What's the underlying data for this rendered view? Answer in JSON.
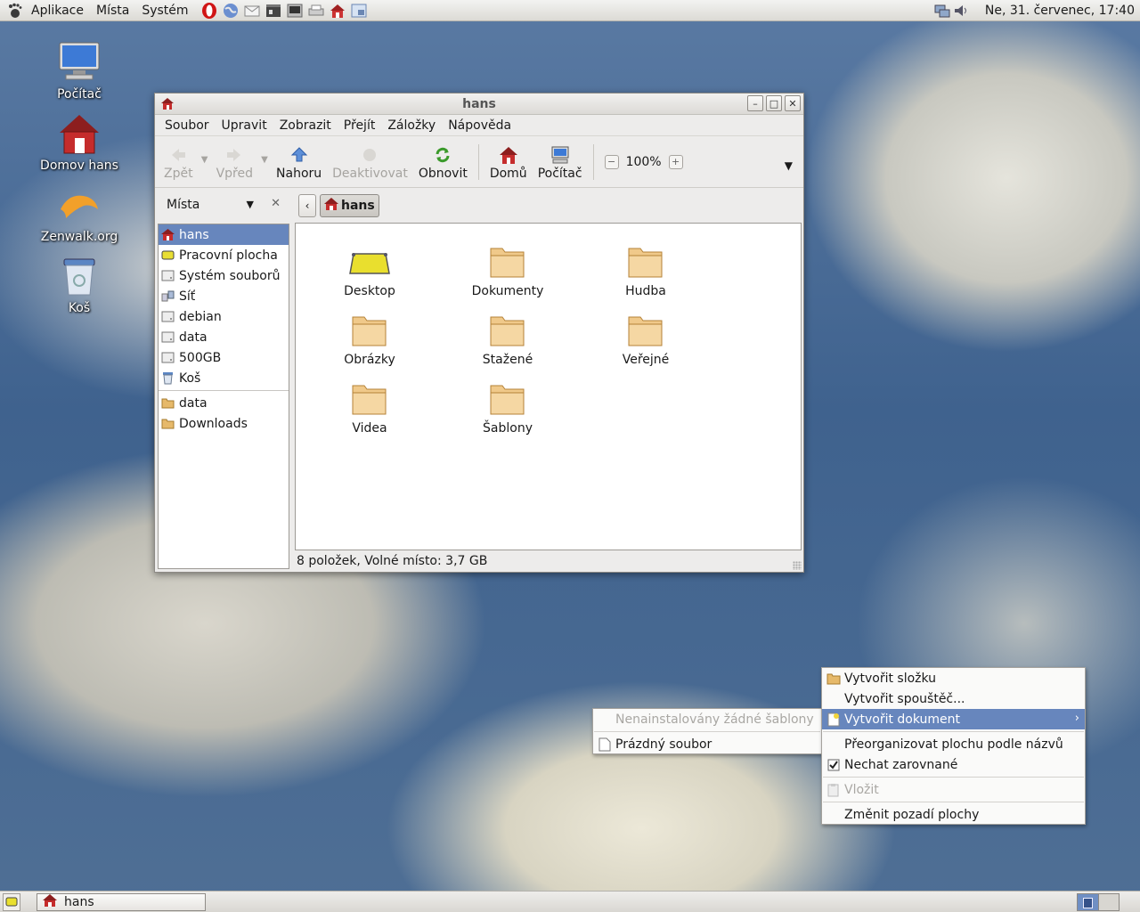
{
  "top_panel": {
    "menus": [
      "Aplikace",
      "Místa",
      "Systém"
    ],
    "launchers": [
      "opera-icon",
      "globe-icon",
      "mail-icon",
      "media-icon",
      "terminal-icon",
      "printer-icon",
      "home-icon",
      "remote-icon"
    ],
    "clock": "Ne, 31. červenec, 17:40"
  },
  "desktop_icons": [
    {
      "label": "Počítač",
      "icon": "computer-icon"
    },
    {
      "label": "Domov hans",
      "icon": "home-icon"
    },
    {
      "label": "Zenwalk.org",
      "icon": "dolphin-icon"
    },
    {
      "label": "Koš",
      "icon": "trash-icon"
    }
  ],
  "window": {
    "title": "hans",
    "menubar": [
      "Soubor",
      "Upravit",
      "Zobrazit",
      "Přejít",
      "Záložky",
      "Nápověda"
    ],
    "toolbar": {
      "back": "Zpět",
      "forward": "Vpřed",
      "up": "Nahoru",
      "stop": "Deaktivovat",
      "reload": "Obnovit",
      "home": "Domů",
      "computer": "Počítač",
      "zoom": "100%"
    },
    "sidebar": {
      "header": "Místa",
      "items": [
        {
          "label": "hans",
          "icon": "home-icon"
        },
        {
          "label": "Pracovní plocha",
          "icon": "desktop-icon"
        },
        {
          "label": "Systém souborů",
          "icon": "drive-icon"
        },
        {
          "label": "Síť",
          "icon": "network-icon"
        },
        {
          "label": "debian",
          "icon": "drive-icon"
        },
        {
          "label": "data",
          "icon": "drive-icon"
        },
        {
          "label": "500GB",
          "icon": "drive-icon"
        },
        {
          "label": "Koš",
          "icon": "trash-icon"
        }
      ],
      "bookmarks": [
        {
          "label": "data",
          "icon": "folder-icon"
        },
        {
          "label": "Downloads",
          "icon": "folder-icon"
        }
      ]
    },
    "pathbar": {
      "crumb": "hans"
    },
    "files": [
      {
        "label": "Desktop",
        "icon": "desktop-icon"
      },
      {
        "label": "Dokumenty",
        "icon": "folder-icon"
      },
      {
        "label": "Hudba",
        "icon": "folder-icon"
      },
      {
        "label": "Obrázky",
        "icon": "folder-icon"
      },
      {
        "label": "Stažené",
        "icon": "folder-icon"
      },
      {
        "label": "Veřejné",
        "icon": "folder-icon"
      },
      {
        "label": "Videa",
        "icon": "folder-icon"
      },
      {
        "label": "Šablony",
        "icon": "folder-icon"
      }
    ],
    "status": "8 položek, Volné místo: 3,7 GB"
  },
  "context_menu": {
    "items": {
      "new_folder": "Vytvořit složku",
      "new_launcher": "Vytvořit spouštěč...",
      "new_document": "Vytvořit dokument",
      "reorganize": "Přeorganizovat plochu podle názvů",
      "keep_aligned": "Nechat zarovnané",
      "paste": "Vložit",
      "change_bg": "Změnit pozadí plochy"
    }
  },
  "submenu": {
    "no_templates": "Nenainstalovány žádné šablony",
    "empty_file": "Prázdný soubor"
  },
  "bottom_panel": {
    "task": "hans"
  }
}
